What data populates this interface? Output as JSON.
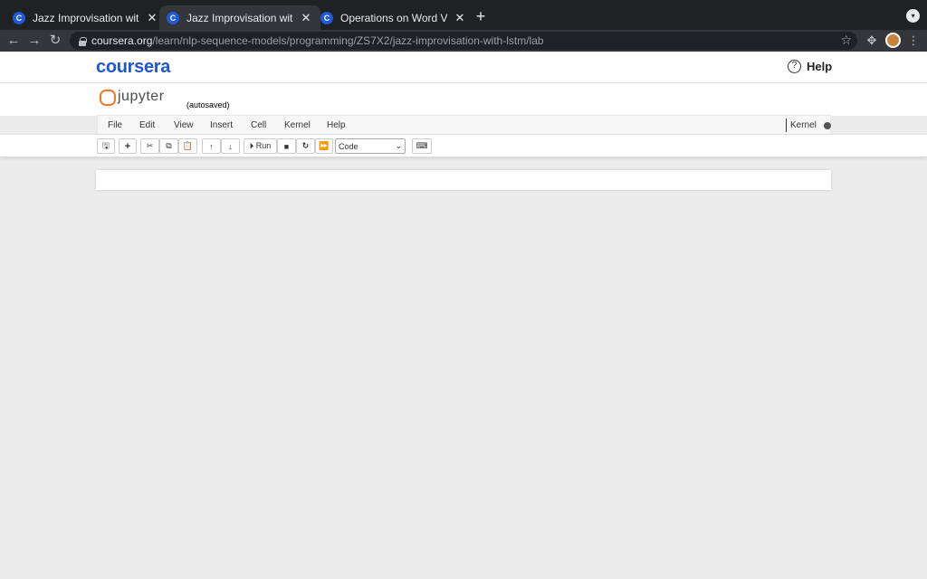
{
  "browser": {
    "tabs": [
      {
        "title": "Jazz Improvisation with LSTM",
        "favicon": "C",
        "close": "✕",
        "active": false
      },
      {
        "title": "Jazz Improvisation with LSTM",
        "favicon": "C",
        "close": "✕",
        "active": true
      },
      {
        "title": "Operations on Word Vectors - ",
        "favicon": "C",
        "close": "✕",
        "active": false
      }
    ],
    "new_tab": "+",
    "url_host": "coursera.org",
    "url_path": "/learn/nlp-sequence-models/programming/ZS7X2/jazz-improvisation-with-lstm/lab",
    "icons": {
      "back": "back-arrow-icon",
      "forward": "forward-arrow-icon",
      "reload": "reload-icon",
      "bookmark": "star-icon",
      "extensions": "puzzle-icon",
      "menu": "kebab-menu-icon"
    }
  },
  "coursera": {
    "logo": "coursera",
    "help_label": "Help",
    "help_icon": "?",
    "brand_color": "#1f57d1"
  },
  "jupyter": {
    "logo_text": "jupyter",
    "autosave_status": "(autosaved)",
    "menu": [
      "File",
      "Edit",
      "View",
      "Insert",
      "Cell",
      "Kernel",
      "Help"
    ],
    "kernel_label": "Kernel",
    "toolbar": {
      "save": "🖫",
      "add": "+",
      "cut": "✂",
      "copy": "⧉",
      "paste": "📋",
      "up": "↑",
      "down": "↓",
      "run": "⏵ Run",
      "stop": "■",
      "restart": "↻",
      "fast_forward": "⏩",
      "cell_type": "Code",
      "keyboard": "⌨"
    }
  }
}
